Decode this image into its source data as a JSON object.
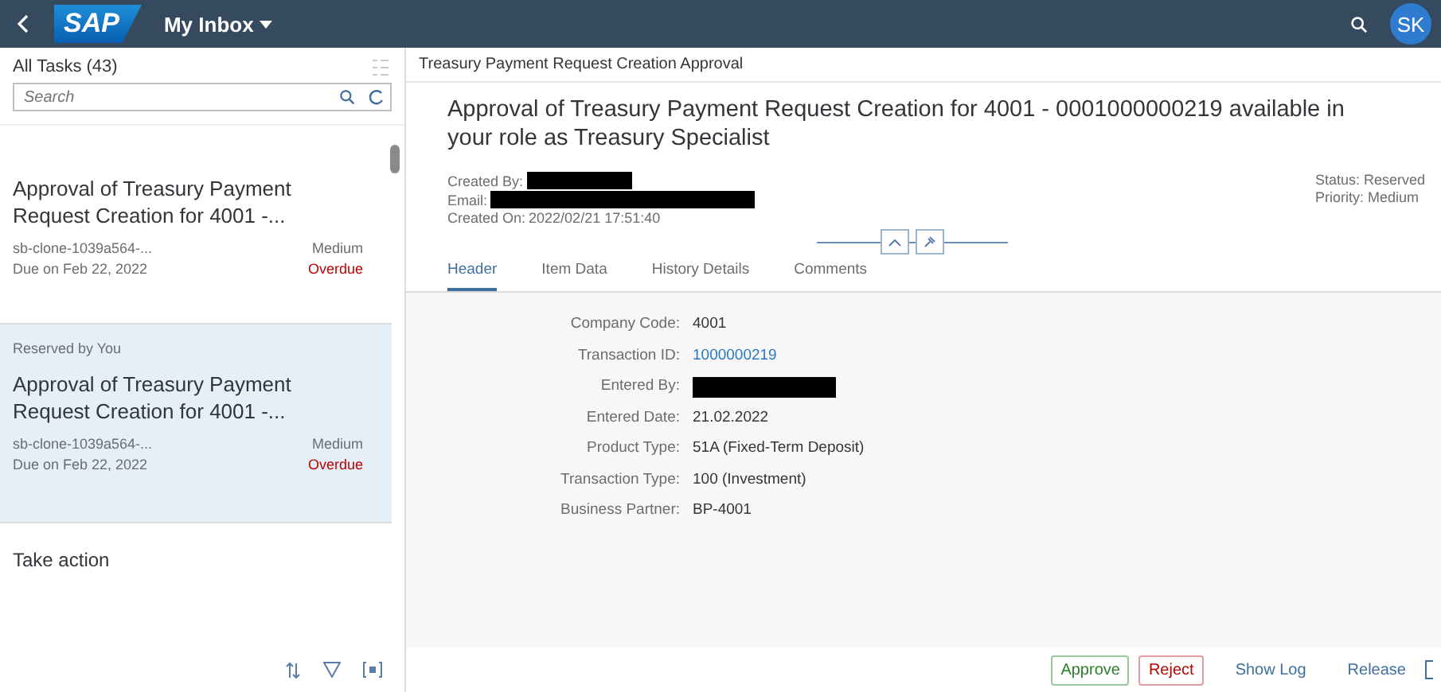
{
  "shell": {
    "app_title": "My Inbox",
    "logo": "SAP",
    "user_initials": "SK"
  },
  "master": {
    "title": "All Tasks (43)",
    "search_placeholder": "Search",
    "tasks": [
      {
        "selected": false,
        "title": "Approval of Treasury Payment Request Creation for 4001 -...",
        "origin": "sb-clone-1039a564-...",
        "priority": "Medium",
        "due": "Due on Feb 22, 2022",
        "status": "Overdue"
      },
      {
        "selected": true,
        "reserved": "Reserved by You",
        "title": "Approval of Treasury Payment Request Creation for 4001 -...",
        "origin": "sb-clone-1039a564-...",
        "priority": "Medium",
        "due": "Due on Feb 22, 2022",
        "status": "Overdue"
      }
    ],
    "take_action": "Take action"
  },
  "detail": {
    "title": "Treasury Payment Request Creation Approval",
    "heading": "Approval of Treasury Payment Request Creation for 4001 - 0001000000219 available in your role as Treasury Specialist",
    "attributes": [
      {
        "label": "Created By:",
        "kind": "redacted"
      },
      {
        "label": "Email:",
        "kind": "redacted"
      },
      {
        "label": "Created On:",
        "kind": "text",
        "value": "2022/02/21 17:51:40"
      }
    ],
    "status": [
      "Status: Reserved",
      "Priority: Medium"
    ],
    "tabs": [
      {
        "label": "Header",
        "selected": true
      },
      {
        "label": "Item Data",
        "selected": false
      },
      {
        "label": "History Details",
        "selected": false
      },
      {
        "label": "Comments",
        "selected": false
      }
    ],
    "fields": [
      {
        "label": "Company Code:",
        "kind": "text",
        "value": "4001"
      },
      {
        "label": "Transaction ID:",
        "kind": "link",
        "value": "1000000219"
      },
      {
        "label": "Entered By:",
        "kind": "redacted"
      },
      {
        "label": "Entered Date:",
        "kind": "text",
        "value": "21.02.2022"
      },
      {
        "label": "Product Type:",
        "kind": "text",
        "value": "51A (Fixed-Term Deposit)"
      },
      {
        "label": "Transaction Type:",
        "kind": "text",
        "value": "100 (Investment)"
      },
      {
        "label": "Business Partner:",
        "kind": "text",
        "value": "BP-4001"
      }
    ],
    "actions": [
      {
        "label": "Approve",
        "kind": "accept"
      },
      {
        "label": "Reject",
        "kind": "reject"
      },
      {
        "label": "Show Log",
        "kind": "plain"
      },
      {
        "label": "Release",
        "kind": "plain"
      }
    ]
  }
}
